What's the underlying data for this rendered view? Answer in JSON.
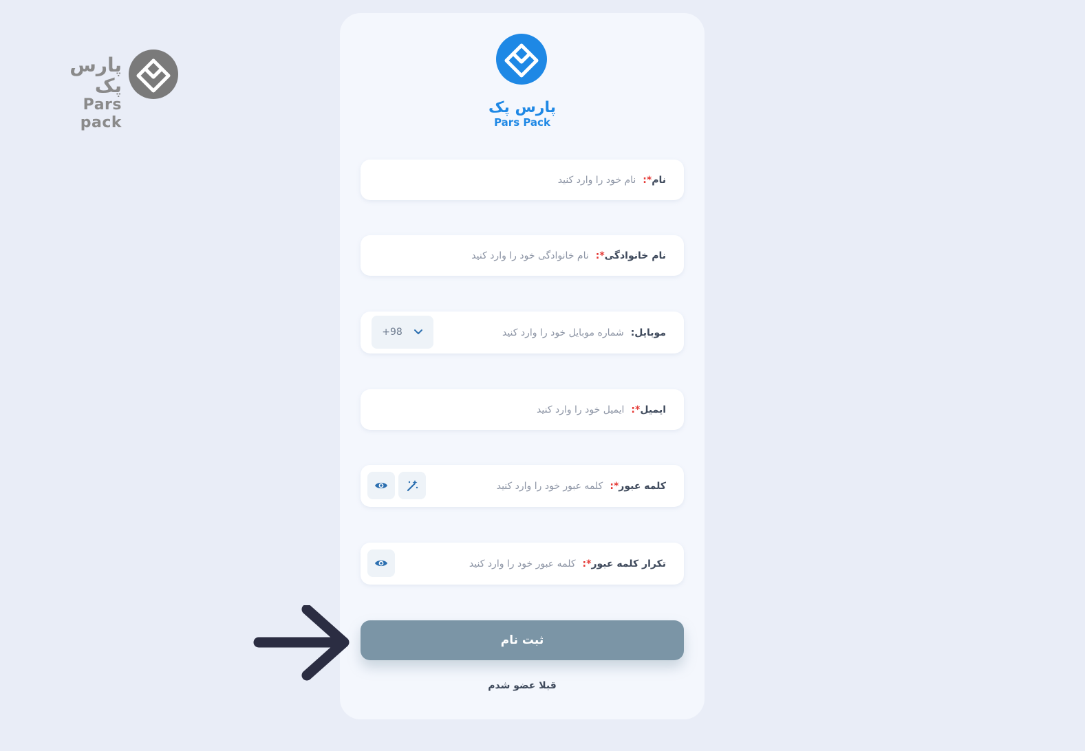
{
  "watermark": {
    "brand_fa": "پارس پک",
    "brand_en": "Pars pack"
  },
  "logo": {
    "brand_fa": "پارس پک",
    "brand_en": "Pars Pack"
  },
  "form": {
    "first_name": {
      "label": "نام",
      "required": "*:",
      "placeholder": "نام خود را وارد کنید"
    },
    "last_name": {
      "label": "نام خانوادگی",
      "required": "*:",
      "placeholder": "نام خانوادگی خود را وارد کنید"
    },
    "mobile": {
      "label": "موبایل:",
      "placeholder": "شماره موبایل خود را وارد کنید",
      "country_code": "+98"
    },
    "email": {
      "label": "ایمیل",
      "required": "*:",
      "placeholder": "ایمیل خود را وارد کنید"
    },
    "password": {
      "label": "کلمه عبور",
      "required": "*:",
      "placeholder": "کلمه عبور خود را وارد کنید"
    },
    "password_repeat": {
      "label": "تکرار کلمه عبور",
      "required": "*:",
      "placeholder": "کلمه عبور خود را وارد کنید"
    },
    "submit_label": "ثبت نام",
    "already_member": "قبلا عضو شدم"
  },
  "icons": {
    "dropdown": "chevron-down-icon",
    "eye": "eye-icon",
    "generate": "magic-wand-icon",
    "pointer": "arrow-right-icon"
  },
  "colors": {
    "brand_blue": "#1e88e5",
    "submit_bg": "#7b95a6",
    "required_star": "#e53935",
    "arrow": "#2b2d42"
  }
}
